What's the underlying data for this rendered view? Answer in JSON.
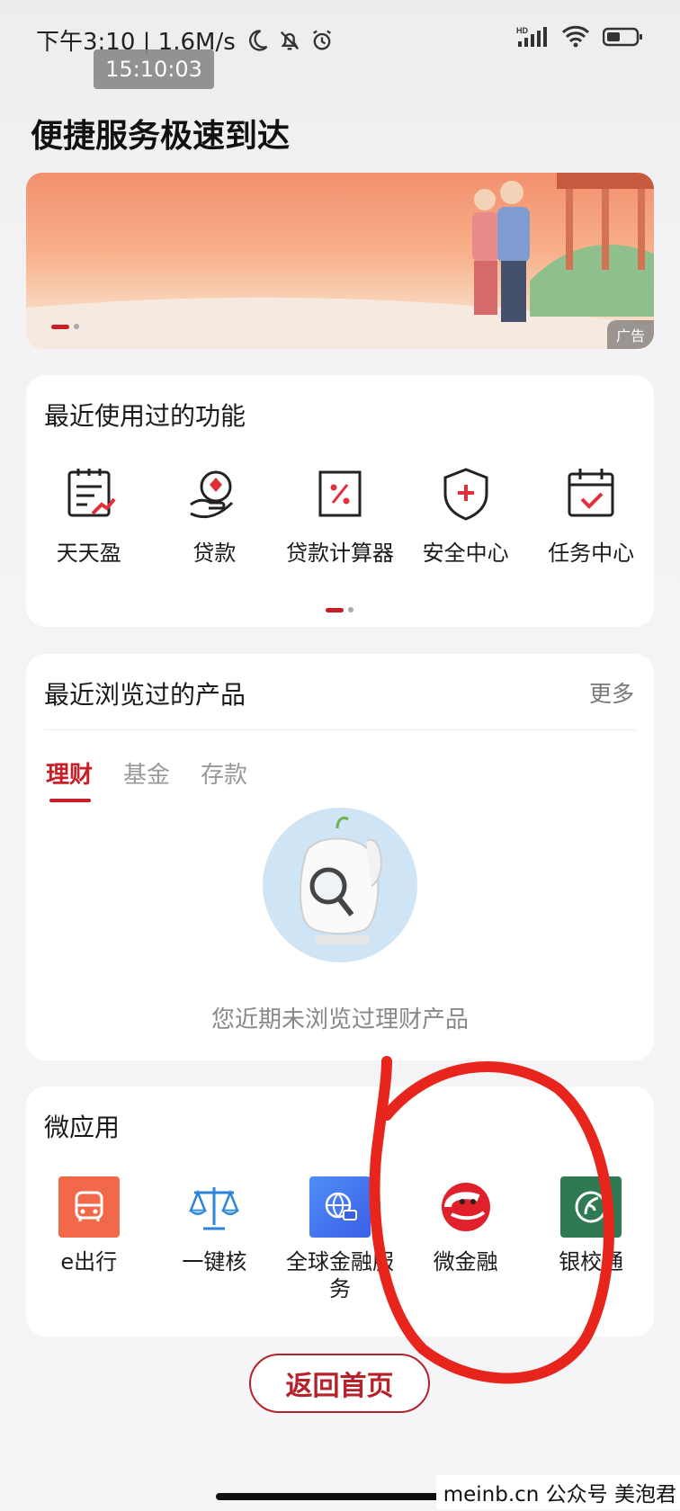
{
  "status_bar": {
    "time_text": "下午3:10 | 1.6M/s",
    "clock_overlay": "15:10:03",
    "icons_left": [
      "moon-icon",
      "bell-off-icon",
      "alarm-icon"
    ],
    "icons_right": [
      "hd-signal-icon",
      "wifi-icon",
      "battery-icon"
    ]
  },
  "page": {
    "title": "便捷服务极速到达"
  },
  "banner": {
    "ad_label": "广告",
    "slides": 2,
    "active_slide": 1
  },
  "recent_functions": {
    "title": "最近使用过的功能",
    "items": [
      {
        "label": "天天盈",
        "icon": "yield-doc-icon"
      },
      {
        "label": "贷款",
        "icon": "loan-hand-icon"
      },
      {
        "label": "贷款计算器",
        "icon": "percent-calculator-icon"
      },
      {
        "label": "安全中心",
        "icon": "shield-plus-icon"
      },
      {
        "label": "任务中心",
        "icon": "calendar-check-icon"
      }
    ],
    "pages": 2,
    "active_page": 1
  },
  "recent_products": {
    "title": "最近浏览过的产品",
    "more": "更多",
    "tabs": [
      {
        "label": "理财",
        "active": true
      },
      {
        "label": "基金",
        "active": false
      },
      {
        "label": "存款",
        "active": false
      }
    ],
    "empty_text": "您近期未浏览过理财产品"
  },
  "micro_apps": {
    "title": "微应用",
    "items": [
      {
        "label": "e出行",
        "icon": "bus-icon",
        "color": "#f2694a"
      },
      {
        "label": "一键核",
        "icon": "scales-icon",
        "color": "#3a8ee0"
      },
      {
        "label": "全球金融服务",
        "icon": "globe-card-icon",
        "color": "#3e6ff0"
      },
      {
        "label": "微金融",
        "icon": "micro-finance-logo-icon",
        "color": "#e0202a"
      },
      {
        "label": "银校通",
        "icon": "leaf-logo-icon",
        "color": "#2f7a52"
      }
    ]
  },
  "return_button": {
    "label": "返回首页"
  },
  "watermark": {
    "text": "meinb.cn  公众号 美泡君"
  },
  "colors": {
    "brand_red": "#c81e28",
    "annotation_red": "#e8251c"
  }
}
